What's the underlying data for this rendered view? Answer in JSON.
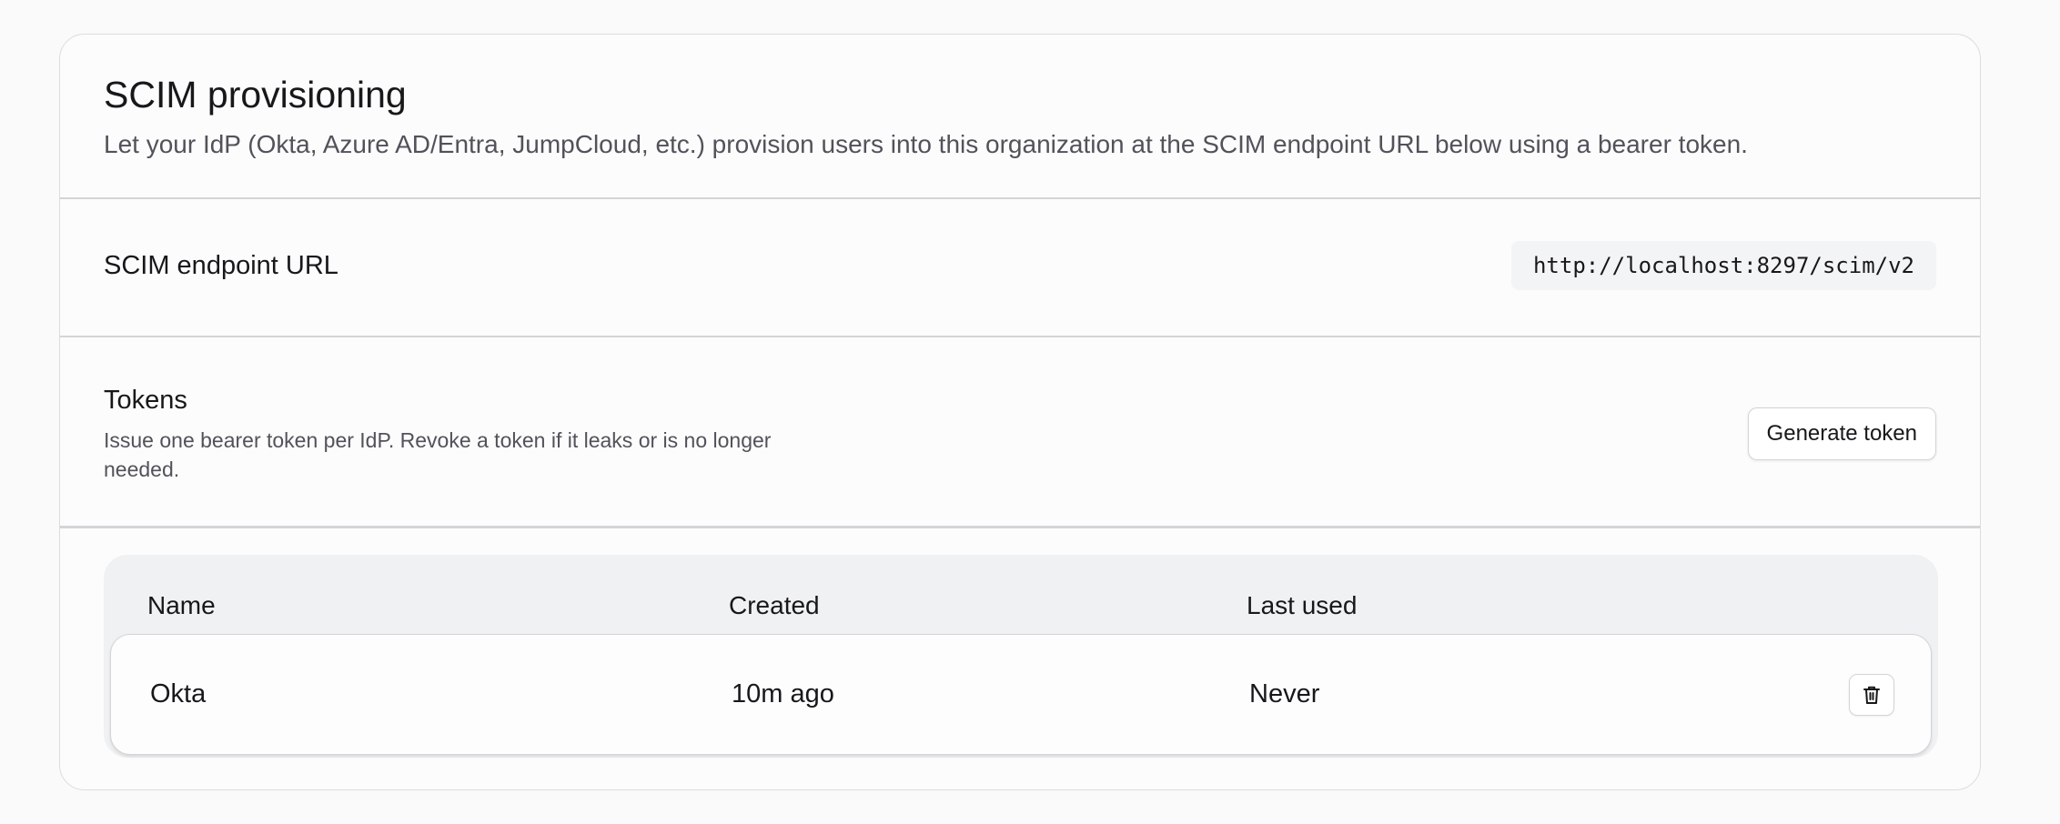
{
  "scim": {
    "title": "SCIM provisioning",
    "description": "Let your IdP (Okta, Azure AD/Entra, JumpCloud, etc.) provision users into this organization at the SCIM endpoint URL below using a bearer token."
  },
  "endpoint": {
    "label": "SCIM endpoint URL",
    "url": "http://localhost:8297/scim/v2"
  },
  "tokens": {
    "title": "Tokens",
    "description": "Issue one bearer token per IdP. Revoke a token if it leaks or is no longer needed.",
    "generate_label": "Generate token",
    "columns": [
      "Name",
      "Created",
      "Last used"
    ],
    "rows": [
      {
        "name": "Okta",
        "created": "10m ago",
        "last_used": "Never",
        "action_icon": "trash-icon"
      }
    ]
  }
}
